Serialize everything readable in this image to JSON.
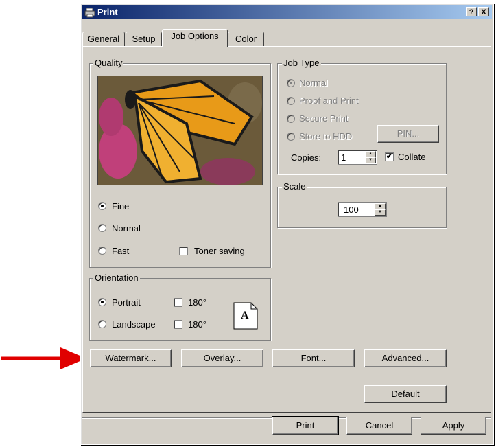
{
  "window": {
    "title": "Print",
    "help_btn": "?",
    "close_btn": "X"
  },
  "tabs": [
    {
      "label": "General",
      "active": false
    },
    {
      "label": "Setup",
      "active": false
    },
    {
      "label": "Job Options",
      "active": true
    },
    {
      "label": "Color",
      "active": false
    }
  ],
  "quality": {
    "group_label": "Quality",
    "image_alt": "butterfly-photo",
    "options": [
      {
        "label": "Fine",
        "selected": true
      },
      {
        "label": "Normal",
        "selected": false
      },
      {
        "label": "Fast",
        "selected": false
      }
    ],
    "toner_saving": {
      "label": "Toner saving",
      "checked": false
    }
  },
  "orientation": {
    "group_label": "Orientation",
    "portrait": {
      "label": "Portrait",
      "selected": true,
      "rotate_label": "180°",
      "rotate_checked": false
    },
    "landscape": {
      "label": "Landscape",
      "selected": false,
      "rotate_label": "180°",
      "rotate_checked": false
    },
    "preview_letter": "A"
  },
  "job_type": {
    "group_label": "Job Type",
    "options": [
      {
        "label": "Normal",
        "selected": true,
        "enabled": false
      },
      {
        "label": "Proof and Print",
        "selected": false,
        "enabled": false
      },
      {
        "label": "Secure Print",
        "selected": false,
        "enabled": false
      },
      {
        "label": "Store to HDD",
        "selected": false,
        "enabled": false
      }
    ],
    "pin_button": "PIN...",
    "copies_label": "Copies:",
    "copies_value": "1",
    "collate": {
      "label": "Collate",
      "checked": true
    }
  },
  "scale": {
    "group_label": "Scale",
    "value": "100"
  },
  "buttons": {
    "watermark": "Watermark...",
    "overlay": "Overlay...",
    "font": "Font...",
    "advanced": "Advanced...",
    "default": "Default",
    "print": "Print",
    "cancel": "Cancel",
    "apply": "Apply"
  },
  "colors": {
    "title_start": "#0a246a",
    "title_end": "#a6caf0",
    "face": "#d4d0c8",
    "arrow": "#e00000"
  }
}
